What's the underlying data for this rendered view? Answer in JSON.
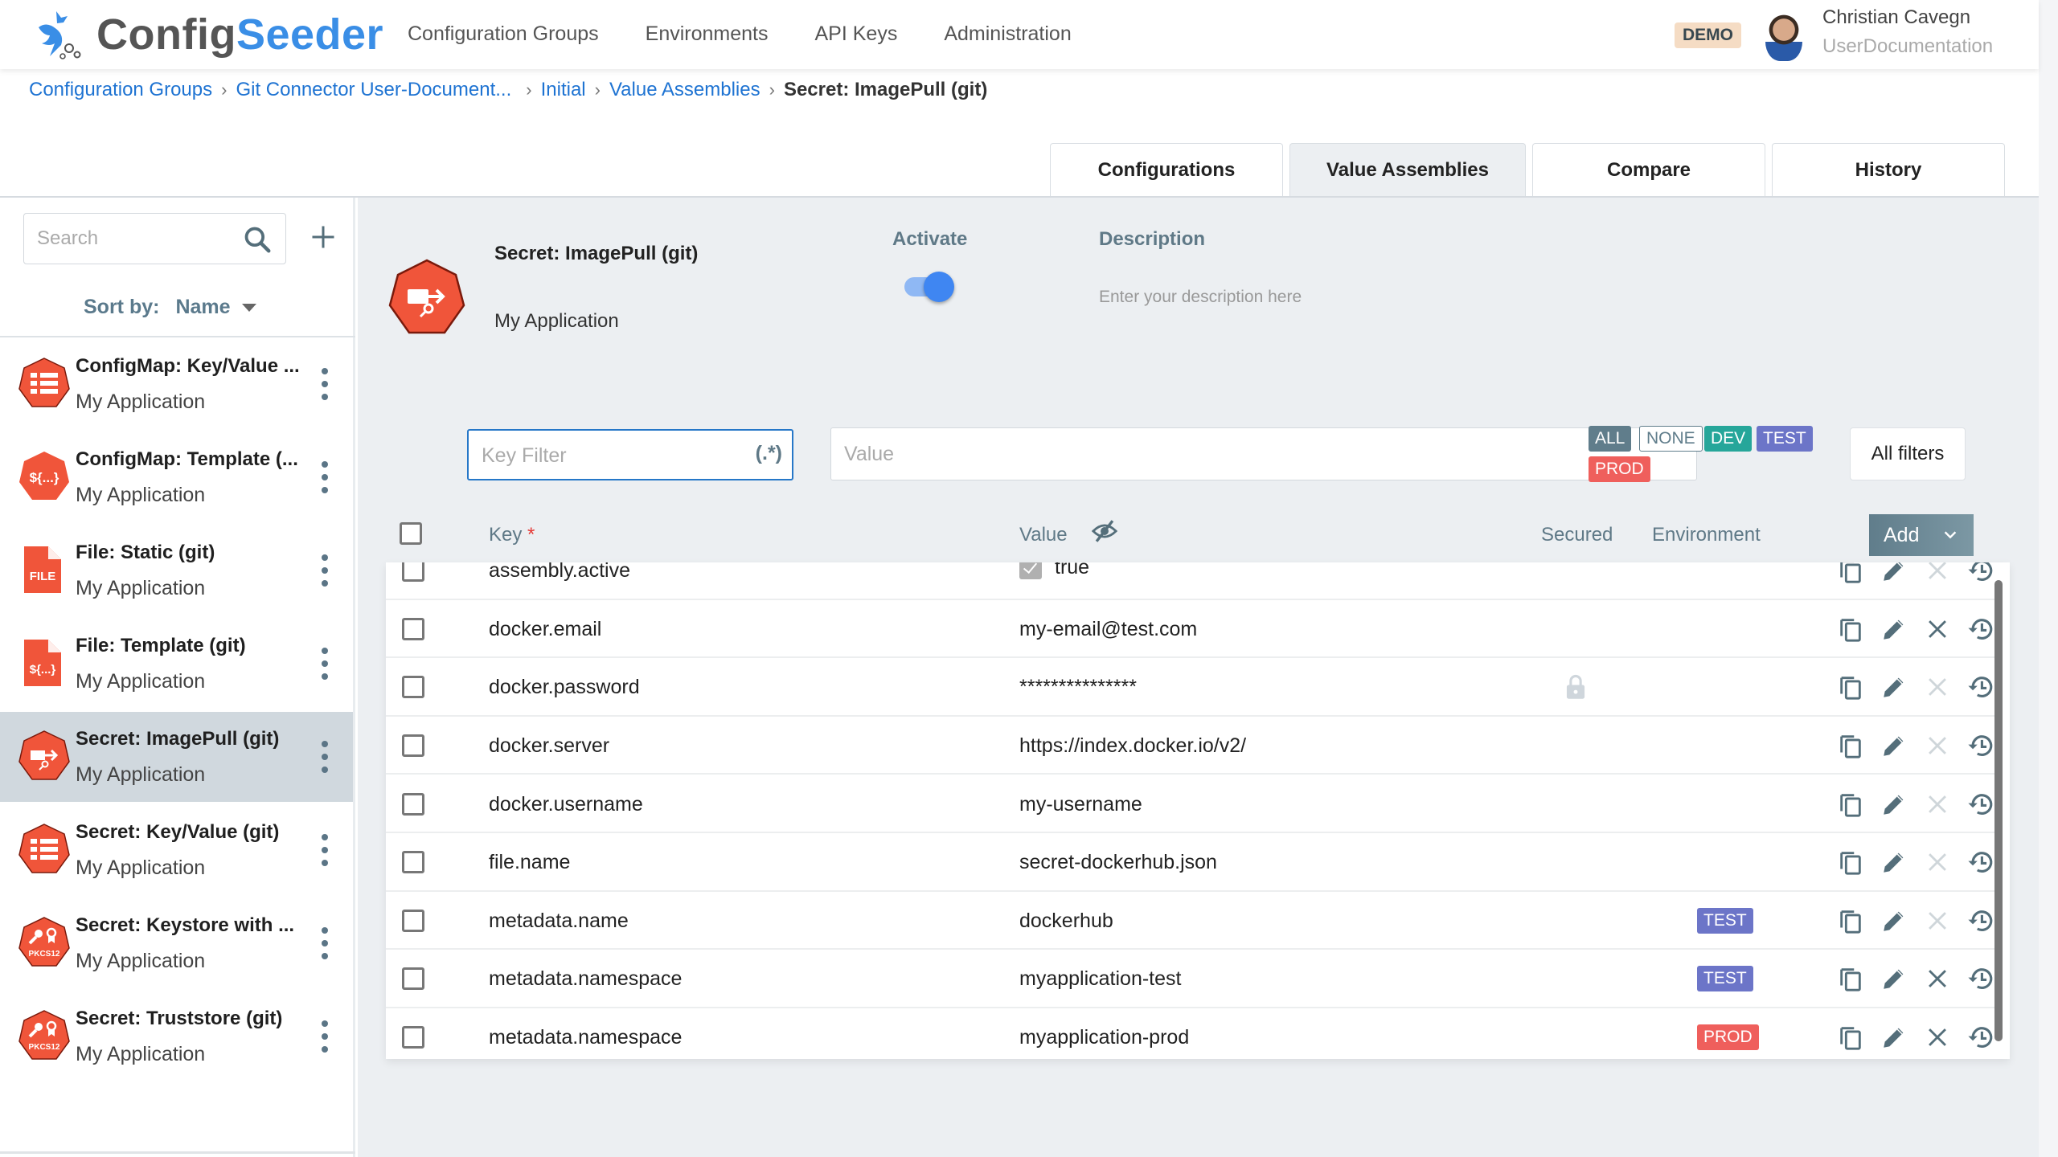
{
  "header": {
    "logo_part1": "Config",
    "logo_part2": "Seeder",
    "nav": [
      "Configuration Groups",
      "Environments",
      "API Keys",
      "Administration"
    ],
    "badge": "DEMO",
    "user_name": "Christian Cavegn",
    "user_org": "UserDocumentation"
  },
  "breadcrumb": {
    "items": [
      "Configuration Groups",
      "Git Connector User-Document...",
      "Initial",
      "Value Assemblies"
    ],
    "current": "Secret: ImagePull (git)"
  },
  "tabs": [
    {
      "label": "Configurations",
      "active": false
    },
    {
      "label": "Value Assemblies",
      "active": true
    },
    {
      "label": "Compare",
      "active": false
    },
    {
      "label": "History",
      "active": false
    }
  ],
  "sidebar": {
    "search_placeholder": "Search",
    "sort_label": "Sort by:",
    "sort_value": "Name",
    "items": [
      {
        "title": "ConfigMap: Key/Value ...",
        "subtitle": "My Application",
        "icon": "keyvalue-heptagon-icon",
        "selected": false
      },
      {
        "title": "ConfigMap: Template (...",
        "subtitle": "My Application",
        "icon": "template-heptagon-icon",
        "selected": false
      },
      {
        "title": "File: Static (git)",
        "subtitle": "My Application",
        "icon": "file-icon",
        "selected": false
      },
      {
        "title": "File: Template (git)",
        "subtitle": "My Application",
        "icon": "file-template-icon",
        "selected": false
      },
      {
        "title": "Secret: ImagePull (git)",
        "subtitle": "My Application",
        "icon": "imagepull-heptagon-icon",
        "selected": true
      },
      {
        "title": "Secret: Key/Value (git)",
        "subtitle": "My Application",
        "icon": "keyvalue-heptagon-icon",
        "selected": false
      },
      {
        "title": "Secret: Keystore with ...",
        "subtitle": "My Application",
        "icon": "pkcs12-heptagon-icon",
        "selected": false
      },
      {
        "title": "Secret: Truststore (git)",
        "subtitle": "My Application",
        "icon": "pkcs12-heptagon-icon",
        "selected": false
      }
    ]
  },
  "detail": {
    "title": "Secret: ImagePull (git)",
    "subtitle": "My Application",
    "activate_label": "Activate",
    "activate_on": true,
    "description_label": "Description",
    "description_placeholder": "Enter your description here"
  },
  "filters": {
    "key_placeholder": "Key Filter",
    "regex_label": "(.*)",
    "value_placeholder": "Value",
    "env_chips": [
      {
        "label": "ALL",
        "color": "#607d8b"
      },
      {
        "label": "NONE",
        "color": "outline"
      },
      {
        "label": "DEV",
        "color": "#26a69a"
      },
      {
        "label": "TEST",
        "color": "#6c75c8"
      },
      {
        "label": "PROD",
        "color": "#ef5f5c"
      }
    ],
    "all_filters_label": "All filters"
  },
  "table": {
    "headers": {
      "key": "Key",
      "key_required": "*",
      "value": "Value",
      "secured": "Secured",
      "environment": "Environment"
    },
    "add_label": "Add",
    "rows": [
      {
        "key": "assembly.active",
        "value": "true",
        "boolean": true,
        "secured": false,
        "env": "",
        "delete_enabled": false
      },
      {
        "key": "docker.email",
        "value": "my-email@test.com",
        "boolean": false,
        "secured": false,
        "env": "",
        "delete_enabled": true
      },
      {
        "key": "docker.password",
        "value": "***************",
        "boolean": false,
        "secured": true,
        "env": "",
        "delete_enabled": false
      },
      {
        "key": "docker.server",
        "value": "https://index.docker.io/v2/",
        "boolean": false,
        "secured": false,
        "env": "",
        "delete_enabled": false
      },
      {
        "key": "docker.username",
        "value": "my-username",
        "boolean": false,
        "secured": false,
        "env": "",
        "delete_enabled": false
      },
      {
        "key": "file.name",
        "value": "secret-dockerhub.json",
        "boolean": false,
        "secured": false,
        "env": "",
        "delete_enabled": false
      },
      {
        "key": "metadata.name",
        "value": "dockerhub",
        "boolean": false,
        "secured": false,
        "env": "TEST",
        "delete_enabled": false
      },
      {
        "key": "metadata.namespace",
        "value": "myapplication-test",
        "boolean": false,
        "secured": false,
        "env": "TEST",
        "delete_enabled": true
      },
      {
        "key": "metadata.namespace",
        "value": "myapplication-prod",
        "boolean": false,
        "secured": false,
        "env": "PROD",
        "delete_enabled": true
      }
    ]
  },
  "colors": {
    "brand_blue": "#3a8ee6",
    "accent_red": "#f0553a",
    "test": "#6c75c8",
    "prod": "#ef5f5c",
    "dev": "#26a69a",
    "icon_slate": "#546e7a"
  }
}
